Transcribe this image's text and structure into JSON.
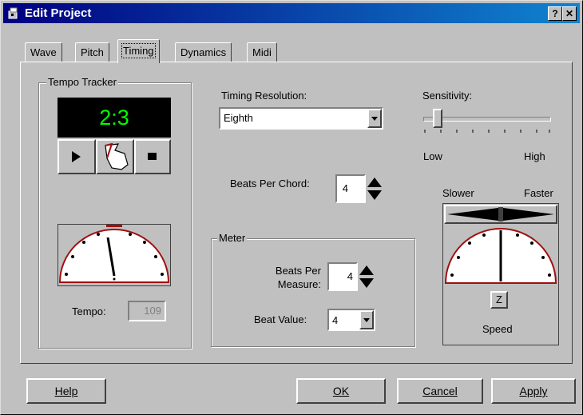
{
  "window": {
    "title": "Edit Project",
    "help_glyph": "?",
    "close_glyph": "✕"
  },
  "tabs": [
    {
      "label": "Wave",
      "active": false
    },
    {
      "label": "Pitch",
      "active": false
    },
    {
      "label": "Timing",
      "active": true
    },
    {
      "label": "Dynamics",
      "active": false
    },
    {
      "label": "Midi",
      "active": false
    }
  ],
  "tempo_tracker": {
    "group_label": "Tempo Tracker",
    "display_value": "2:3",
    "tempo_label": "Tempo:",
    "tempo_value": "109"
  },
  "timing_resolution": {
    "label": "Timing Resolution:",
    "value": "Eighth"
  },
  "beats_per_chord": {
    "label": "Beats Per Chord:",
    "value": "4"
  },
  "meter": {
    "group_label": "Meter",
    "beats_per_measure_label_line1": "Beats Per",
    "beats_per_measure_label_line2": "Measure:",
    "beats_per_measure_value": "4",
    "beat_value_label": "Beat Value:",
    "beat_value": "4"
  },
  "sensitivity": {
    "label": "Sensitivity:",
    "low_label": "Low",
    "high_label": "High",
    "level": 0.12
  },
  "speed": {
    "slower_label": "Slower",
    "faster_label": "Faster",
    "z_button": "Z",
    "label": "Speed"
  },
  "buttons": {
    "help": "Help",
    "ok": "OK",
    "cancel": "Cancel",
    "apply": "Apply"
  },
  "colors": {
    "title_bar": "#000080",
    "display_bg": "#000000",
    "display_fg": "#00ff00",
    "dial_rim": "#a01010"
  }
}
